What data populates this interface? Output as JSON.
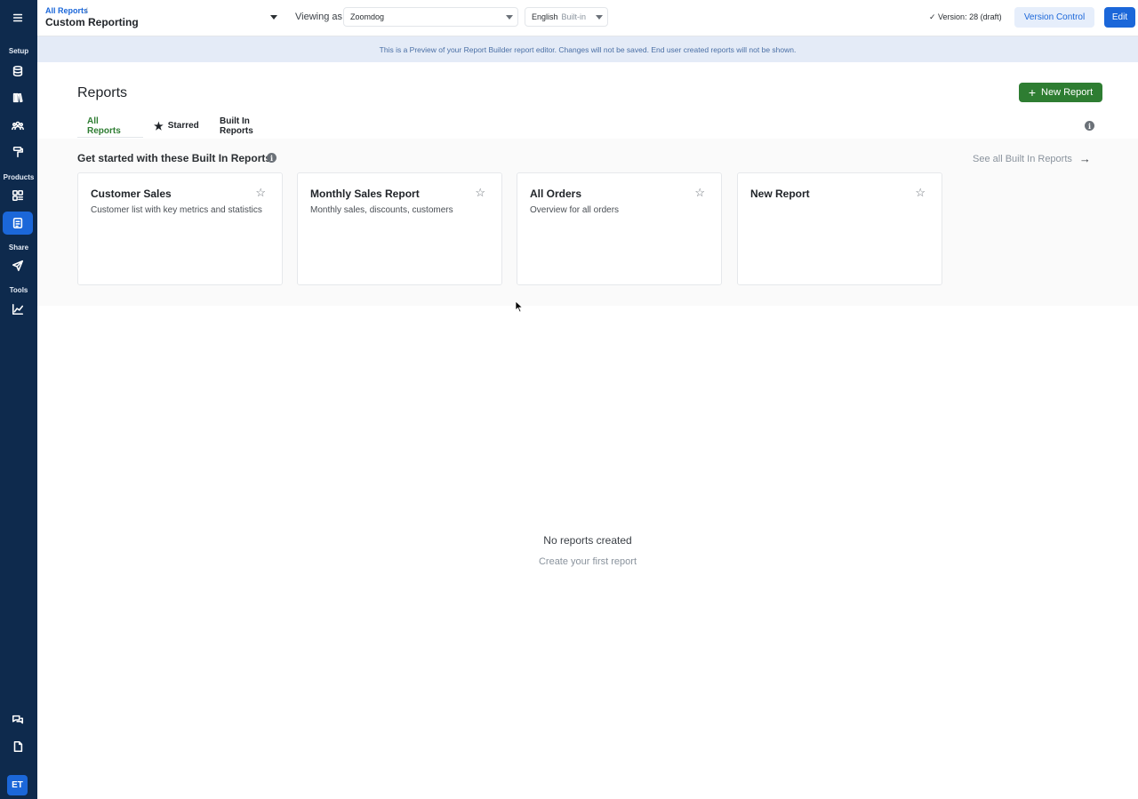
{
  "sidebar": {
    "menu_icon": "menu-icon",
    "sections": {
      "setup": "Setup",
      "products": "Products",
      "share": "Share",
      "tools": "Tools"
    },
    "avatar": "ET"
  },
  "header": {
    "breadcrumb_link": "All Reports",
    "breadcrumb_sep": "/",
    "title": "Custom Reporting",
    "viewing_as_label": "Viewing as",
    "viewing_as_value": "Zoomdog",
    "language_value": "English",
    "language_sub": "Built-in",
    "version_text": "Version: 28 (draft)",
    "version_control": "Version Control",
    "edit": "Edit"
  },
  "banner": {
    "text": "This is a Preview of your Report Builder report editor. Changes will not be saved. End user created reports will not be shown."
  },
  "main": {
    "title": "Reports",
    "new_report_button": "New Report",
    "tabs": [
      {
        "label": "All Reports",
        "active": true
      },
      {
        "label": "Starred",
        "active": false
      },
      {
        "label": "Built In Reports",
        "active": false
      }
    ],
    "builtin": {
      "title": "Get started with these Built In Reports",
      "see_all": "See all Built In Reports",
      "cards": [
        {
          "title": "Customer Sales",
          "desc": "Customer list with key metrics and statistics"
        },
        {
          "title": "Monthly Sales Report",
          "desc": "Monthly sales, discounts, customers"
        },
        {
          "title": "All Orders",
          "desc": "Overview for all orders"
        },
        {
          "title": "New Report",
          "desc": ""
        }
      ]
    },
    "empty": {
      "title": "No reports created",
      "subtitle": "Create your first report"
    }
  },
  "colors": {
    "sidebar": "#0e2a4d",
    "accent_blue": "#1b67d9",
    "accent_green": "#2e7d32",
    "banner": "#e4ebf7"
  }
}
